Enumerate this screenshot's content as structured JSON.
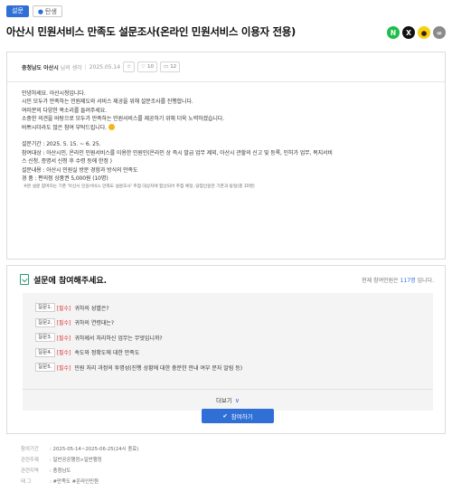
{
  "tags": {
    "survey": "설문",
    "citizen": "탄생"
  },
  "title": "아산시 민원서비스 만족도 설문조사(온라인 민원서비스 이용자 전용)",
  "share": {
    "naver": "N",
    "x": "X",
    "kakao": "●",
    "link": "∞"
  },
  "meta": {
    "author": "충청남도 아산시",
    "author_suffix": "님의 생각",
    "date": "2025.05.14",
    "likes": "10",
    "comments": "12"
  },
  "body": {
    "lines": [
      "안녕하세요. 아산시청입니다.",
      "시민 모두가 만족하는 민원제도와 서비스 제공을 위해 설문조사를 진행합니다.",
      "여러분의 다양한 목소리를 들려주세요.",
      "소중한 의견을 바탕으로 모두가 만족하는 민원서비스를 제공하기 위해 더욱 노력하겠습니다.",
      "바쁘시더라도 많은 참여 부탁드립니다."
    ],
    "details": [
      "설문기간 : 2025. 5. 15. ~ 6. 25.",
      "참여대상 : 아산시민, 온라인 민원서비스를 이용한 민원인(온라인 상 즉시 발급 업무 제외, 아산시 관할의 신고 및 등록, 인허가 업무, 복지서비",
      "스 신청, 증명서 신청 후 수령 등에 한정 )",
      "설문내용 : 아산시 민원실 방문 경험과 방식의 만족도",
      "경 품 : 편의점 상품권 5,000원 (10명)"
    ],
    "note": "※본 설문 참여자는 기존 '아산시 민원서비스 만족도 설문조사' 추첨 대상자에 함산되어 추첨 예정, 당첨인원은 기존과 동일(총 10명)"
  },
  "survey": {
    "heading": "설문에 참여해주세요.",
    "count_prefix": "현재 참여인원은",
    "count_value": "117명",
    "count_suffix": "입니다.",
    "questions": [
      {
        "num": "질문1.",
        "req": "[필수]",
        "text": "귀하의 성별은?"
      },
      {
        "num": "질문2.",
        "req": "[필수]",
        "text": "귀하의 연령대는?"
      },
      {
        "num": "질문3.",
        "req": "[필수]",
        "text": "귀하께서 처리하신 업무는 무엇입니까?"
      },
      {
        "num": "질문4.",
        "req": "[필수]",
        "text": "속도와 정확도에 대한 만족도"
      },
      {
        "num": "질문5.",
        "req": "[필수]",
        "text": "민원 처리 과정의 투명성(진행 상황에 대한 충분한 안내 여부 문자 알림 등)"
      }
    ],
    "more_label": "더보기",
    "join_label": "참여하기"
  },
  "info": [
    {
      "key": "참여기간",
      "value": ": 2025-05-14~2025-06-25(24시 종료)"
    },
    {
      "key": "관련주제",
      "value": ": 일반공공행정>일반행정"
    },
    {
      "key": "관련지역",
      "value": ": 충청남도"
    },
    {
      "key": "태      그",
      "value": ": #만족도 #온라인민원"
    }
  ]
}
